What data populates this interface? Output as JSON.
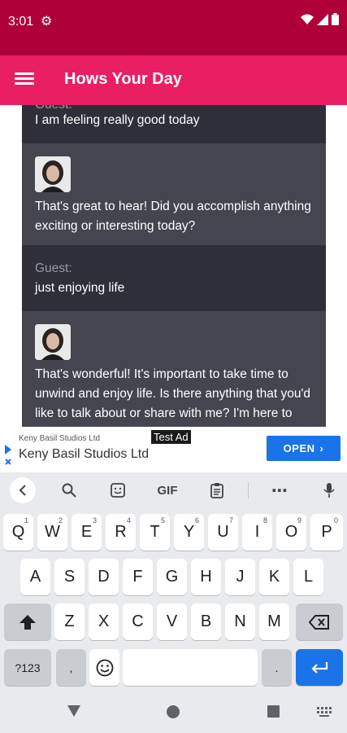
{
  "status": {
    "time": "3:01"
  },
  "app": {
    "title": "Hows Your Day"
  },
  "chat": {
    "top_partial_label": "Guest:",
    "messages": [
      {
        "role": "guest",
        "text": "I am feeling really good today"
      },
      {
        "role": "bot",
        "text": "That's great to hear! Did you accomplish anything exciting or interesting today?"
      },
      {
        "role": "guest",
        "label": "Guest:",
        "text": "just enjoying life"
      },
      {
        "role": "bot",
        "text": "That's wonderful! It's important to take time to unwind and enjoy life. Is there anything that you'd like to talk about or share with me? I'm here to listen!"
      }
    ]
  },
  "ad": {
    "tag": "Test Ad",
    "advertiser_small": "Keny Basil Studios Ltd",
    "advertiser": "Keny Basil Studios Ltd",
    "cta": "OPEN"
  },
  "keyboard": {
    "toolbar": {
      "gif": "GIF"
    },
    "row1": [
      {
        "k": "Q",
        "n": "1"
      },
      {
        "k": "W",
        "n": "2"
      },
      {
        "k": "E",
        "n": "3"
      },
      {
        "k": "R",
        "n": "4"
      },
      {
        "k": "T",
        "n": "5"
      },
      {
        "k": "Y",
        "n": "6"
      },
      {
        "k": "U",
        "n": "7"
      },
      {
        "k": "I",
        "n": "8"
      },
      {
        "k": "O",
        "n": "9"
      },
      {
        "k": "P",
        "n": "0"
      }
    ],
    "row2": [
      "A",
      "S",
      "D",
      "F",
      "G",
      "H",
      "J",
      "K",
      "L"
    ],
    "row3": [
      "Z",
      "X",
      "C",
      "V",
      "B",
      "N",
      "M"
    ],
    "symbols": "?123",
    "comma": ",",
    "period": "."
  }
}
